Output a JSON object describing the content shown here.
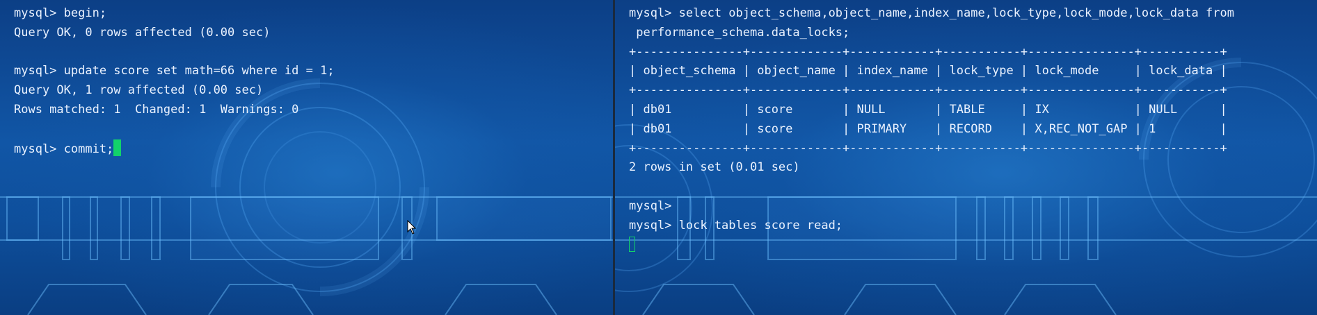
{
  "left_terminal": {
    "lines": [
      "mysql> begin;",
      "Query OK, 0 rows affected (0.00 sec)",
      "",
      "mysql> update score set math=66 where id = 1;",
      "Query OK, 1 row affected (0.00 sec)",
      "Rows matched: 1  Changed: 1  Warnings: 0",
      "",
      "mysql> commit;"
    ],
    "cursor_style": "solid-block"
  },
  "right_terminal": {
    "lines": [
      "mysql> select object_schema,object_name,index_name,lock_type,lock_mode,lock_data from",
      " performance_schema.data_locks;",
      "+---------------+-------------+------------+-----------+---------------+-----------+",
      "| object_schema | object_name | index_name | lock_type | lock_mode     | lock_data |",
      "+---------------+-------------+------------+-----------+---------------+-----------+",
      "| db01          | score       | NULL       | TABLE     | IX            | NULL      |",
      "| db01          | score       | PRIMARY    | RECORD    | X,REC_NOT_GAP | 1         |",
      "+---------------+-------------+------------+-----------+---------------+-----------+",
      "2 rows in set (0.01 sec)",
      "",
      "mysql>",
      "mysql> lock tables score read;",
      ""
    ],
    "cursor_style": "hollow-block"
  },
  "colors": {
    "text": "#eaf2ff",
    "cursor": "#12d36a",
    "background": "#0e4f9c"
  },
  "icons": {
    "mouse_pointer": "arrow-cursor-icon"
  }
}
